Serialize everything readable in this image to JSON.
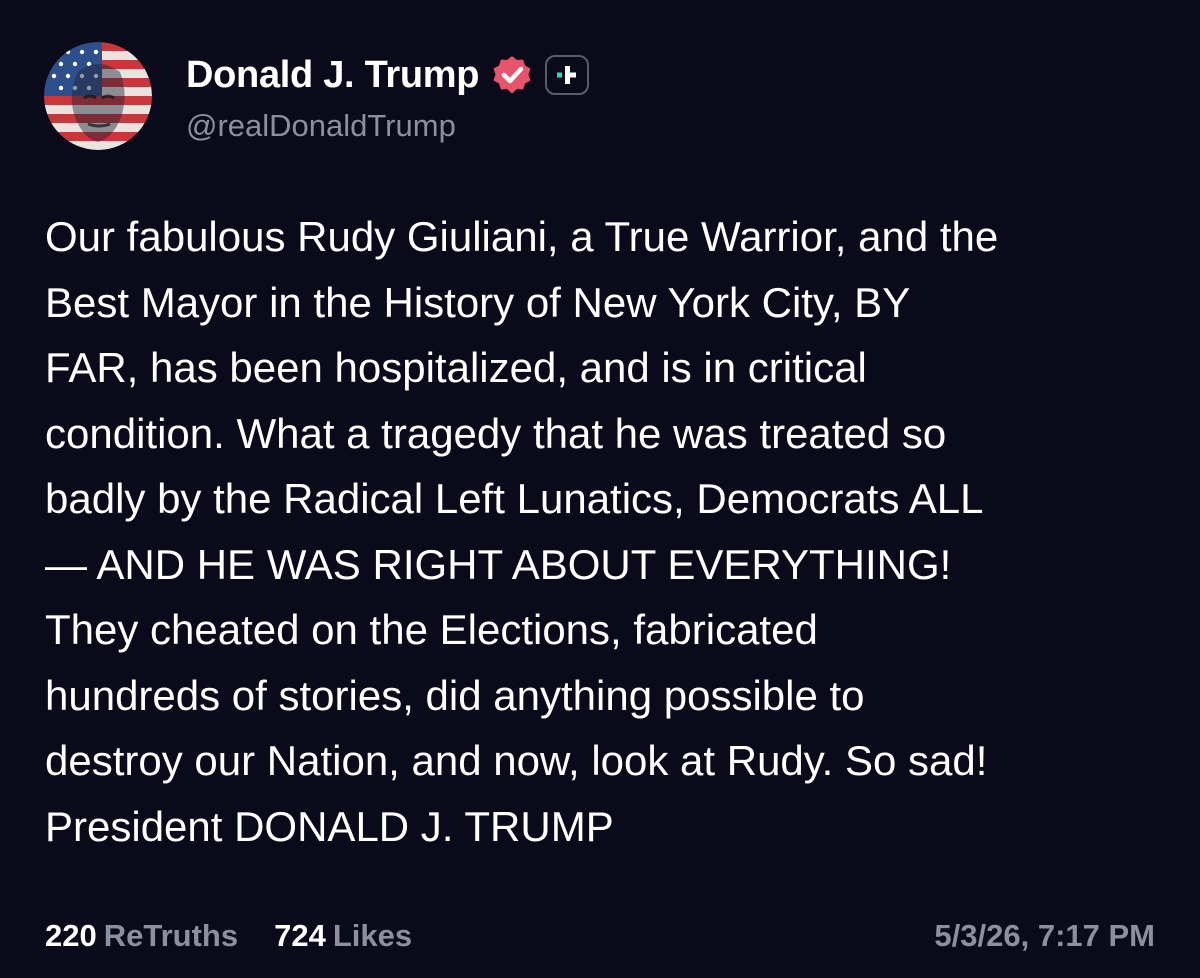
{
  "author": {
    "display_name": "Donald J. Trump",
    "handle": "@realDonaldTrump",
    "avatar_icon": "flag-portrait-avatar",
    "verified_icon": "verified-badge-icon",
    "verified_color": "#e8546b",
    "plus_icon": "truth-plus-icon"
  },
  "post": {
    "lines": [
      "Our fabulous Rudy Giuliani, a True Warrior, and the",
      "Best Mayor in the History of New York City, BY",
      "FAR, has been hospitalized, and is in critical",
      "condition. What a tragedy that he was treated so",
      "badly by the Radical Left Lunatics, Democrats ALL",
      "— AND HE WAS RIGHT ABOUT EVERYTHING!",
      "They cheated on the Elections, fabricated",
      "hundreds of stories, did anything possible to",
      "destroy our Nation, and now, look at Rudy. So sad!",
      "President DONALD J. TRUMP"
    ]
  },
  "stats": {
    "retruths_count": "220",
    "retruths_label": "ReTruths",
    "likes_count": "724",
    "likes_label": "Likes"
  },
  "timestamp": "5/3/26, 7:17 PM",
  "colors": {
    "background": "#0b0a1b",
    "text": "#ffffff",
    "muted": "#8d8f9c",
    "accent": "#e8546b"
  }
}
